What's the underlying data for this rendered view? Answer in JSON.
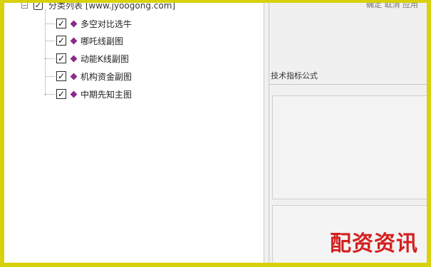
{
  "tree": {
    "root_label": "分类列表 [www.jyoogong.com]",
    "root_expander": "−",
    "items": [
      {
        "label": "多空对比选牛",
        "checked": true
      },
      {
        "label": "哪吒线副图",
        "checked": true
      },
      {
        "label": "动能K线副图",
        "checked": true
      },
      {
        "label": "机构资金副图",
        "checked": true
      },
      {
        "label": "中期先知主图",
        "checked": true
      }
    ]
  },
  "right_panel": {
    "top_clipped_text": "确定 取消 应用",
    "formula_section_label": "技术指标公式"
  },
  "watermark": "配资资讯",
  "colors": {
    "frame": "#d7d20c",
    "diamond": "#8b2a8b",
    "watermark": "#d42020"
  }
}
